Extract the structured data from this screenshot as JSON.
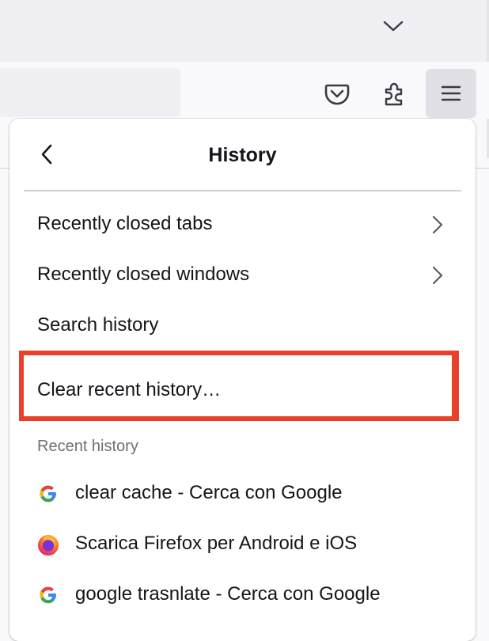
{
  "browser": {
    "toolbar": {
      "list_tabs_icon": "chevron-down-icon",
      "pocket_icon": "pocket-icon",
      "extensions_icon": "puzzle-icon",
      "menu_icon": "hamburger-icon"
    }
  },
  "panel": {
    "title": "History",
    "back_icon": "chevron-left-icon",
    "items": [
      {
        "label": "Recently closed tabs",
        "has_submenu": true
      },
      {
        "label": "Recently closed windows",
        "has_submenu": true
      },
      {
        "label": "Search history",
        "has_submenu": false
      },
      {
        "label": "Clear recent history…",
        "has_submenu": false
      }
    ],
    "highlight_color": "#e8402a",
    "recent_section_label": "Recent history",
    "recent_history": [
      {
        "title": "clear cache - Cerca con Google",
        "favicon": "google-icon"
      },
      {
        "title": "Scarica Firefox per Android e iOS",
        "favicon": "firefox-icon"
      },
      {
        "title": "google trasnlate - Cerca con Google",
        "favicon": "google-icon"
      }
    ]
  }
}
